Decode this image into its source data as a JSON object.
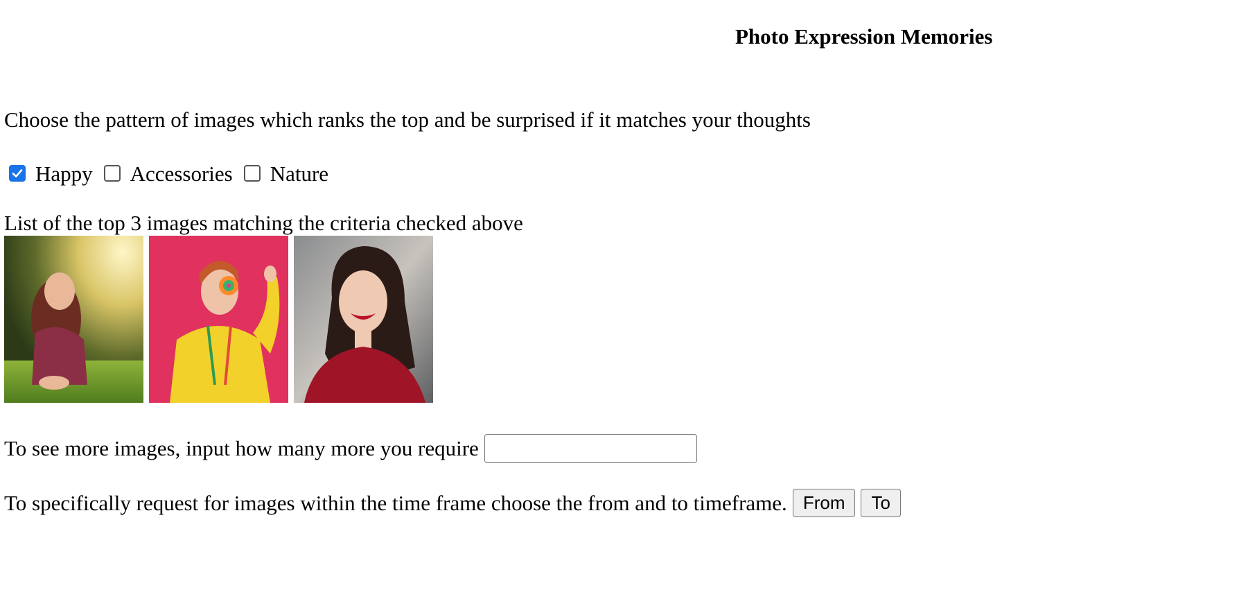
{
  "header": {
    "title": "Photo Expression Memories"
  },
  "intro": {
    "instruction": "Choose the pattern of images which ranks the top and be surprised if it matches your thoughts"
  },
  "filters": [
    {
      "label": "Happy",
      "checked": true
    },
    {
      "label": "Accessories",
      "checked": false
    },
    {
      "label": "Nature",
      "checked": false
    }
  ],
  "results": {
    "label": "List of the top 3 images matching the criteria checked above",
    "images": [
      {
        "subject": "woman lying in sunlit grass"
      },
      {
        "subject": "woman in yellow jacket holding lollipop on pink background"
      },
      {
        "subject": "smiling woman in red top"
      }
    ]
  },
  "more_images": {
    "prompt": "To see more images, input how many more you require",
    "value": "",
    "placeholder": ""
  },
  "timeframe": {
    "prompt": "To specifically request for images within the time frame choose the from and to timeframe.",
    "from_label": "From",
    "to_label": "To"
  },
  "colors": {
    "checkbox_checked": "#1a73e8",
    "button_bg": "#efefef",
    "input_border": "#767676"
  }
}
